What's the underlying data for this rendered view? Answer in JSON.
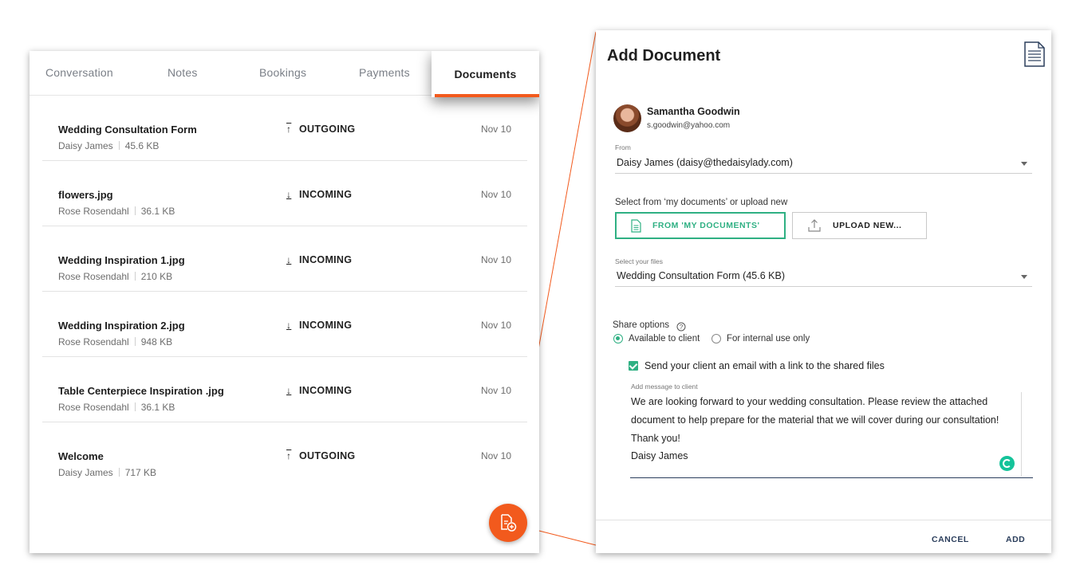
{
  "tabs": [
    "Conversation",
    "Notes",
    "Bookings",
    "Payments",
    "Documents"
  ],
  "active_tab": "Documents",
  "documents": [
    {
      "name": "Wedding Consultation Form",
      "owner": "Daisy James",
      "size": "45.6 KB",
      "direction": "OUTGOING",
      "direction_icon": "upload-arrow-icon",
      "date": "Nov 10"
    },
    {
      "name": "flowers.jpg",
      "owner": "Rose Rosendahl",
      "size": "36.1 KB",
      "direction": "INCOMING",
      "direction_icon": "download-arrow-icon",
      "date": "Nov 10"
    },
    {
      "name": "Wedding Inspiration 1.jpg",
      "owner": "Rose Rosendahl",
      "size": "210 KB",
      "direction": "INCOMING",
      "direction_icon": "download-arrow-icon",
      "date": "Nov 10"
    },
    {
      "name": "Wedding Inspiration 2.jpg",
      "owner": "Rose Rosendahl",
      "size": "948 KB",
      "direction": "INCOMING",
      "direction_icon": "download-arrow-icon",
      "date": "Nov 10"
    },
    {
      "name": "Table Centerpiece Inspiration .jpg",
      "owner": "Rose Rosendahl",
      "size": "36.1 KB",
      "direction": "INCOMING",
      "direction_icon": "download-arrow-icon",
      "date": "Nov 10"
    },
    {
      "name": "Welcome",
      "owner": "Daisy James",
      "size": "717 KB",
      "direction": "OUTGOING",
      "direction_icon": "upload-arrow-icon",
      "date": "Nov 10"
    }
  ],
  "dialog": {
    "title": "Add Document",
    "client": {
      "name": "Samantha Goodwin",
      "email": "s.goodwin@yahoo.com"
    },
    "from_label": "From",
    "from_value": "Daisy James (daisy@thedaisylady.com)",
    "source_prompt": "Select from ‘my documents’ or upload new",
    "from_my_documents_label": "FROM 'MY DOCUMENTS'",
    "upload_new_label": "UPLOAD NEW...",
    "files_label": "Select your files",
    "files_value": "Wedding Consultation Form (45.6 KB)",
    "share_options_label": "Share options",
    "share_option_client": "Available to client",
    "share_option_internal": "For internal use only",
    "email_checkbox_label": "Send your client an email with a link to the shared files",
    "message_label": "Add message to client",
    "message_lines": [
      "We are looking forward to your wedding consultation. Please review the attached",
      "document to help prepare for the material that we will cover during our consultation!",
      "Thank you!",
      "Daisy James"
    ],
    "cancel_label": "CANCEL",
    "add_label": "ADD"
  },
  "colors": {
    "accent_orange": "#f25a1d",
    "accent_green": "#2fb083",
    "navy": "#2b3e5c"
  }
}
